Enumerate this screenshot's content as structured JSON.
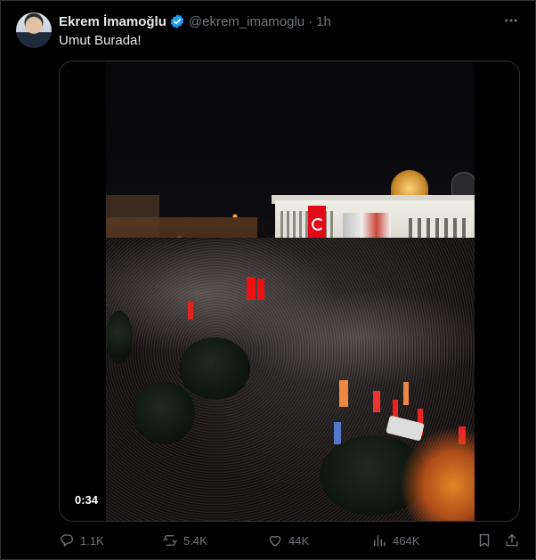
{
  "post": {
    "display_name": "Ekrem İmamoğlu",
    "handle": "@ekrem_imamoglu",
    "separator": "·",
    "time": "1h",
    "more_icon": "more-horizontal-icon",
    "text": "Umut Burada!",
    "verified_color": "#1d9bf0"
  },
  "media": {
    "duration": "0:34"
  },
  "actions": {
    "reply_count": "1.1K",
    "repost_count": "5.4K",
    "like_count": "44K",
    "view_count": "464K",
    "icons": [
      "reply-icon",
      "repost-icon",
      "like-icon",
      "views-icon",
      "bookmark-icon",
      "share-icon"
    ]
  },
  "colors": {
    "background": "#000000",
    "text_primary": "#e7e9ea",
    "text_secondary": "#71767b",
    "border": "#2f3336"
  }
}
